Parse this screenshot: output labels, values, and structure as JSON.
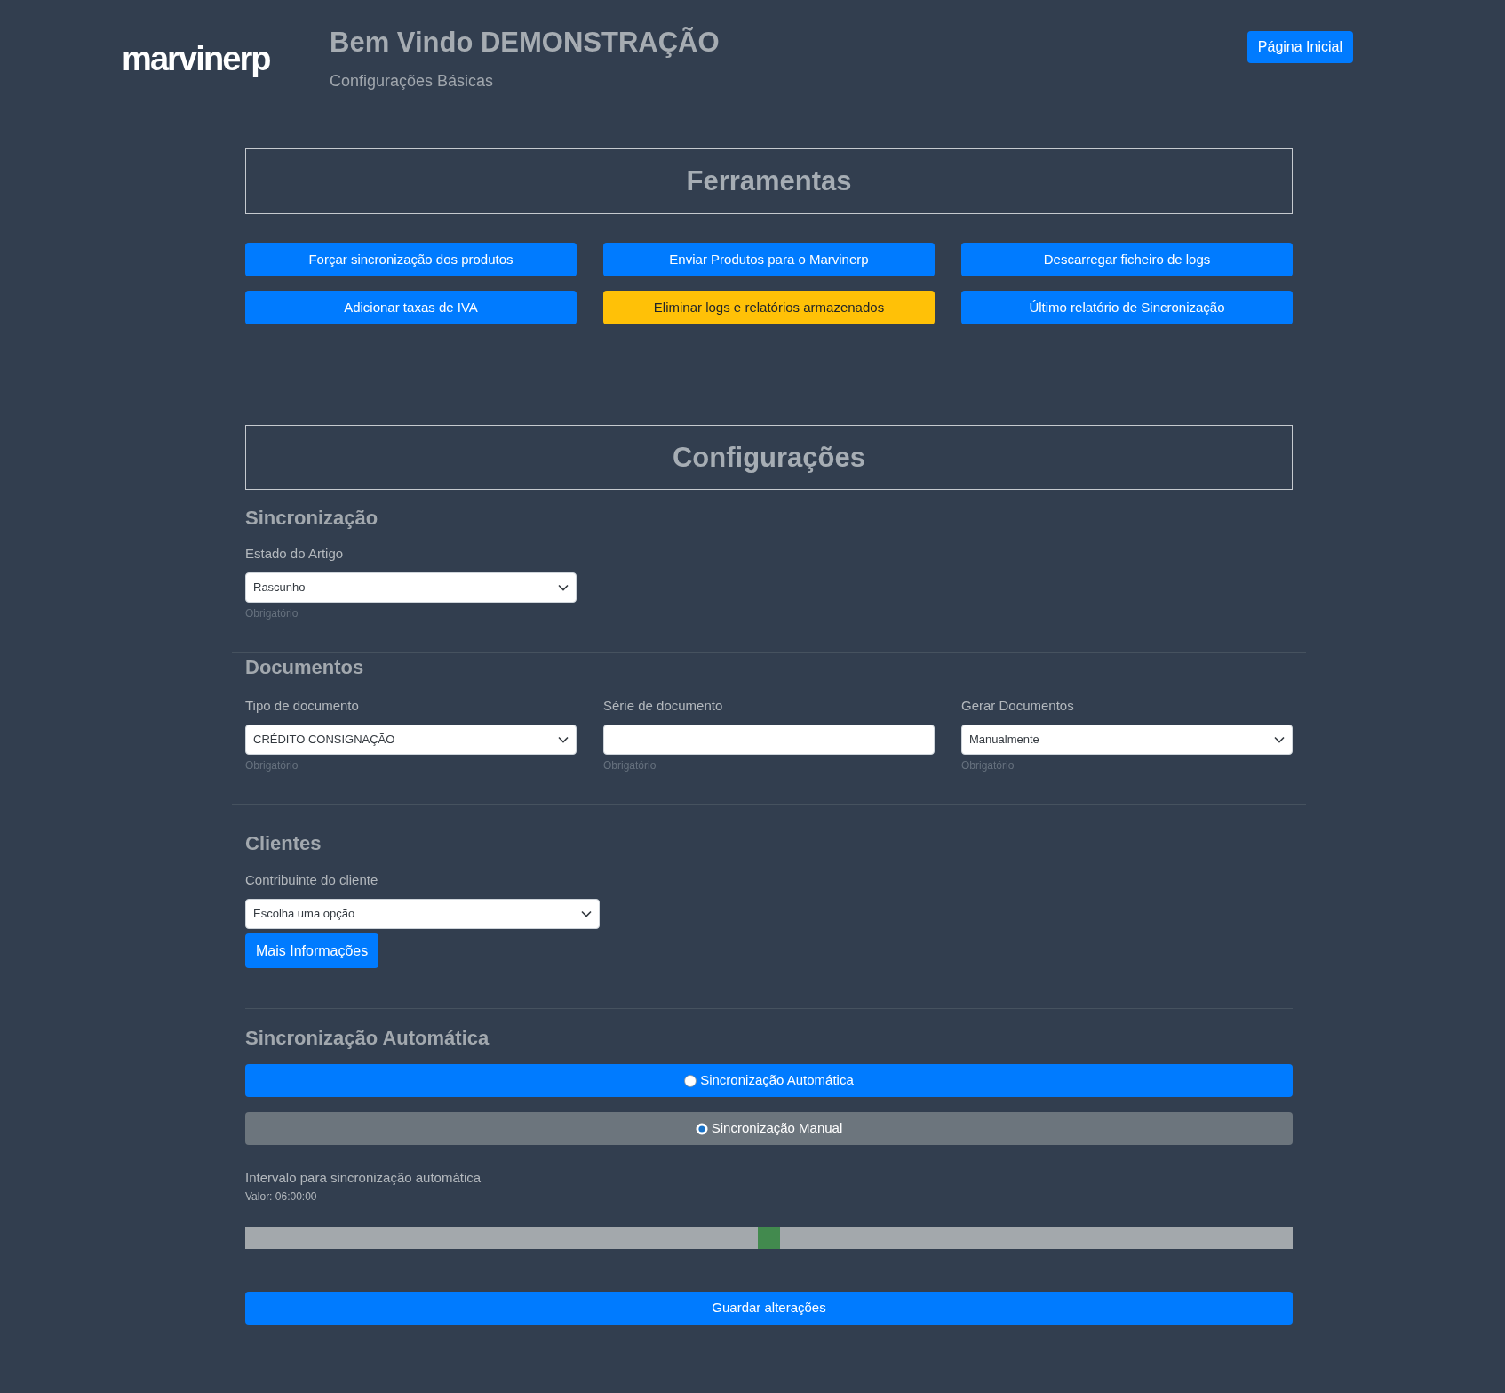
{
  "header": {
    "logo": "marvinerp",
    "title": "Bem Vindo DEMONSTRAÇÃO",
    "subtitle": "Configurações Básicas",
    "home_button": "Página Inicial"
  },
  "tools": {
    "title": "Ferramentas",
    "buttons": [
      {
        "label": "Forçar sincronização dos produtos",
        "kind": "primary"
      },
      {
        "label": "Enviar Produtos para o Marvinerp",
        "kind": "primary"
      },
      {
        "label": "Descarregar ficheiro de logs",
        "kind": "primary"
      },
      {
        "label": "Adicionar taxas de IVA",
        "kind": "primary"
      },
      {
        "label": "Eliminar logs e relatórios armazenados",
        "kind": "warning"
      },
      {
        "label": "Último relatório de Sincronização",
        "kind": "primary"
      }
    ]
  },
  "settings_title": "Configurações",
  "sync": {
    "heading": "Sincronização",
    "fields": [
      {
        "kind": "select",
        "label": "Estado do Artigo",
        "value": "Rascunho",
        "hint": "Obrigatório"
      }
    ]
  },
  "documents": {
    "heading": "Documentos",
    "fields": [
      {
        "kind": "select",
        "label": "Tipo de documento",
        "value": "CRÉDITO CONSIGNAÇÃO",
        "hint": "Obrigatório"
      },
      {
        "kind": "input",
        "label": "Série de documento",
        "hint": "Obrigatório"
      },
      {
        "kind": "select",
        "label": "Gerar Documentos",
        "value": "Manualmente",
        "hint": "Obrigatório"
      }
    ]
  },
  "clients": {
    "heading": "Clientes",
    "fields": [
      {
        "kind": "select",
        "label": "Contribuinte do cliente",
        "value": "Escolha uma opção"
      }
    ],
    "button": "Mais Informações"
  },
  "auto_sync": {
    "heading": "Sincronização Automática",
    "options": [
      {
        "label": "Sincronização Automática",
        "kind": "primary",
        "checked": false
      },
      {
        "label": "Sincronização Manual",
        "kind": "secondary",
        "checked": true
      }
    ],
    "slider": {
      "label": "Intervalo para sincronização automática",
      "reading": "Valor: 06:00:00",
      "level": 0.5
    }
  },
  "save_button": "Guardar alterações"
}
